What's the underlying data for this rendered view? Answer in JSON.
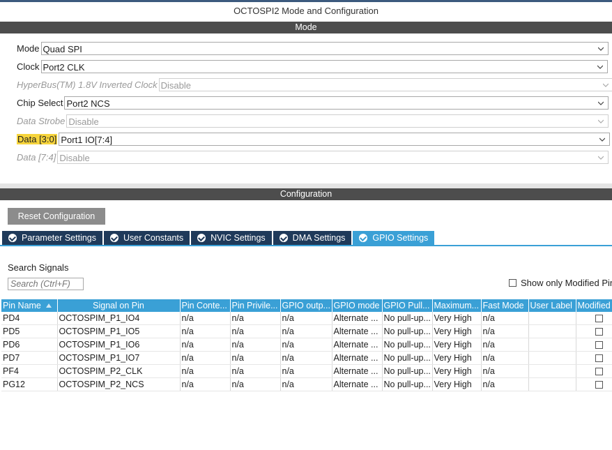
{
  "window": {
    "title": "OCTOSPI2 Mode and Configuration"
  },
  "mode": {
    "header": "Mode",
    "fields": [
      {
        "label": "Mode",
        "value": "Quad SPI",
        "disabled": false,
        "highlight": false
      },
      {
        "label": "Clock",
        "value": "Port2 CLK",
        "disabled": false,
        "highlight": false
      },
      {
        "label": "HyperBus(TM) 1.8V Inverted Clock",
        "value": "Disable",
        "disabled": true,
        "highlight": false
      },
      {
        "label": "Chip Select",
        "value": "Port2 NCS",
        "disabled": false,
        "highlight": false
      },
      {
        "label": "Data Strobe",
        "value": "Disable",
        "disabled": true,
        "highlight": false
      },
      {
        "label": "Data [3:0]",
        "value": "Port1 IO[7:4]",
        "disabled": false,
        "highlight": true
      },
      {
        "label": "Data [7:4]",
        "value": "Disable",
        "disabled": true,
        "highlight": false
      }
    ]
  },
  "configuration": {
    "header": "Configuration",
    "reset_label": "Reset Configuration",
    "tabs": [
      {
        "label": "Parameter Settings",
        "active": false
      },
      {
        "label": "User Constants",
        "active": false
      },
      {
        "label": "NVIC Settings",
        "active": false
      },
      {
        "label": "DMA Settings",
        "active": false
      },
      {
        "label": "GPIO Settings",
        "active": true
      }
    ],
    "search_label": "Search Signals",
    "search_placeholder": "Search (Ctrl+F)",
    "show_modified_label": "Show only Modified Pins"
  },
  "table": {
    "columns": [
      "Pin Name",
      "Signal on Pin",
      "Pin Conte...",
      "Pin Privile...",
      "GPIO outp...",
      "GPIO mode",
      "GPIO Pull...",
      "Maximum...",
      "Fast Mode",
      "User Label",
      "Modified"
    ],
    "rows": [
      [
        "PD4",
        "OCTOSPIM_P1_IO4",
        "n/a",
        "n/a",
        "n/a",
        "Alternate ...",
        "No pull-up...",
        "Very High",
        "n/a",
        ""
      ],
      [
        "PD5",
        "OCTOSPIM_P1_IO5",
        "n/a",
        "n/a",
        "n/a",
        "Alternate ...",
        "No pull-up...",
        "Very High",
        "n/a",
        ""
      ],
      [
        "PD6",
        "OCTOSPIM_P1_IO6",
        "n/a",
        "n/a",
        "n/a",
        "Alternate ...",
        "No pull-up...",
        "Very High",
        "n/a",
        ""
      ],
      [
        "PD7",
        "OCTOSPIM_P1_IO7",
        "n/a",
        "n/a",
        "n/a",
        "Alternate ...",
        "No pull-up...",
        "Very High",
        "n/a",
        ""
      ],
      [
        "PF4",
        "OCTOSPIM_P2_CLK",
        "n/a",
        "n/a",
        "n/a",
        "Alternate ...",
        "No pull-up...",
        "Very High",
        "n/a",
        ""
      ],
      [
        "PG12",
        "OCTOSPIM_P2_NCS",
        "n/a",
        "n/a",
        "n/a",
        "Alternate ...",
        "No pull-up...",
        "Very High",
        "n/a",
        ""
      ]
    ]
  }
}
